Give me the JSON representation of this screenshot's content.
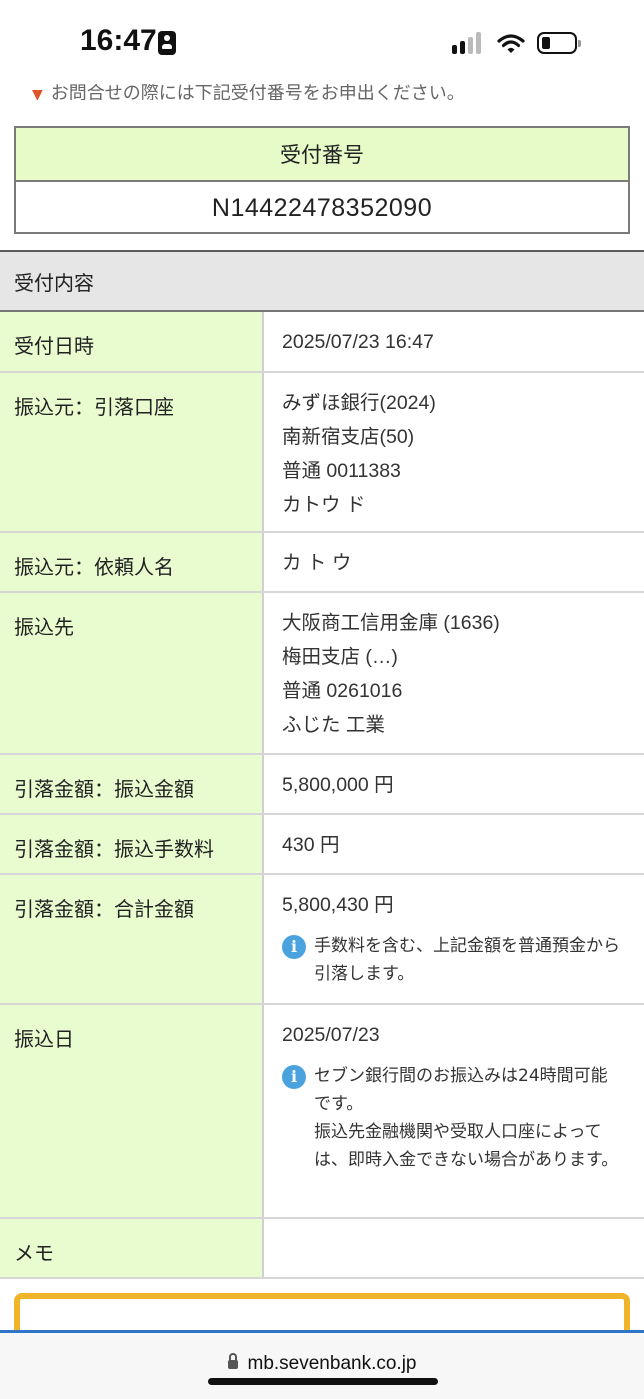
{
  "status_bar": {
    "time": "16:47"
  },
  "top_note": "お問合せの際には下記受付番号をお申出ください。",
  "receipt": {
    "header": "受付番号",
    "number": "N14422478352090"
  },
  "section_title": "受付内容",
  "rows": [
    {
      "label": "受付日時",
      "lines": [
        "2025/07/23 16:47"
      ]
    },
    {
      "label": "振込元：引落口座",
      "lines": [
        "みずほ銀行(2024)",
        "南新宿支店(50)",
        "普通 0011383",
        "カトウ ド"
      ]
    },
    {
      "label": "振込元：依頼人名",
      "lines": [
        "カ ト ウ"
      ]
    },
    {
      "label": "振込先",
      "lines": [
        "大阪商工信用金庫 (1636)",
        "梅田支店 (…)",
        "普通 0261016",
        "ふじた 工業"
      ]
    },
    {
      "label": "引落金額：振込金額",
      "lines": [
        "5,800,000 円"
      ]
    },
    {
      "label": "引落金額：振込手数料",
      "lines": [
        "430 円"
      ]
    },
    {
      "label": "引落金額：合計金額",
      "lines": [
        "5,800,430 円"
      ],
      "note": "手数料を含む、上記金額を普通預金から引落します。"
    },
    {
      "label": "振込日",
      "lines": [
        "2025/07/23"
      ],
      "note": "セブン銀行間のお振込みは24時間可能です。\n振込先金融機関や受取人口座によっては、即時入金できない場合があります。"
    },
    {
      "label": "メモ",
      "lines": []
    }
  ],
  "browser": {
    "url": "mb.sevenbank.co.jp"
  },
  "colors": {
    "label_bg": "#e8fcd0",
    "info_icon": "#4aa3df",
    "warn_border": "#f0b429",
    "url_border": "#2f76c9"
  }
}
